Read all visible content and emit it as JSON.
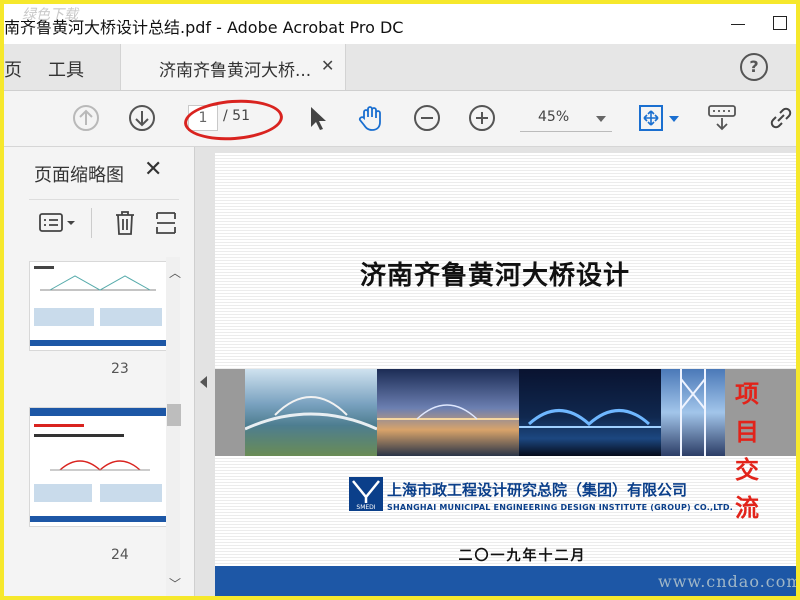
{
  "window": {
    "title": "南齐鲁黄河大桥设计总结.pdf - Adobe Acrobat Pro DC"
  },
  "tabs": {
    "home_partial": "页",
    "tools": "工具",
    "document": "济南齐鲁黄河大桥...",
    "help": "?"
  },
  "toolbar": {
    "current_page": "1",
    "total_pages": "/ 51",
    "zoom": "45%"
  },
  "sidebar": {
    "title": "页面缩略图",
    "pages": [
      {
        "number": "23"
      },
      {
        "number": "24"
      }
    ]
  },
  "document": {
    "title": "济南齐鲁黄河大桥设计",
    "banner_text_line1": "项 目",
    "banner_text_line2": "交 流",
    "logo_text": "SMEDI",
    "org_cn": "上海市政工程设计研究总院（集团）有限公司",
    "org_en": "SHANGHAI MUNICIPAL ENGINEERING DESIGN INSTITUTE (GROUP) CO.,LTD.",
    "date": "二〇一九年十二月"
  },
  "watermarks": {
    "top_left": "绿色下载",
    "bottom_right": "www.cndao.com"
  },
  "colors": {
    "frame": "#f6e82c",
    "annotation": "#d9231f",
    "brand_blue": "#1d57a6",
    "banner_red": "#e2231a"
  }
}
